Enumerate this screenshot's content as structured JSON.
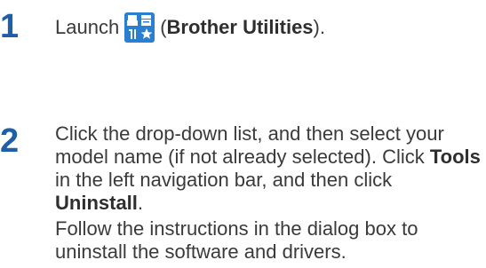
{
  "steps": [
    {
      "number": "1",
      "text_before_icon": "Launch",
      "icon": "brother-utilities-icon",
      "text_open_paren": "(",
      "text_bold": "Brother Utilities",
      "text_close_paren": ")."
    },
    {
      "number": "2",
      "p1_part1": "Click the drop-down list, and then select your model name (if not already selected). Click ",
      "p1_bold1": "Tools",
      "p1_part2": " in the left navigation bar, and then click ",
      "p1_bold2": "Uninstall",
      "p1_part3": ".",
      "p2": "Follow the instructions in the dialog box to uninstall the software and drivers."
    }
  ],
  "colors": {
    "step_number": "#1f5ea8",
    "icon_bg": "#2a7fd0"
  }
}
